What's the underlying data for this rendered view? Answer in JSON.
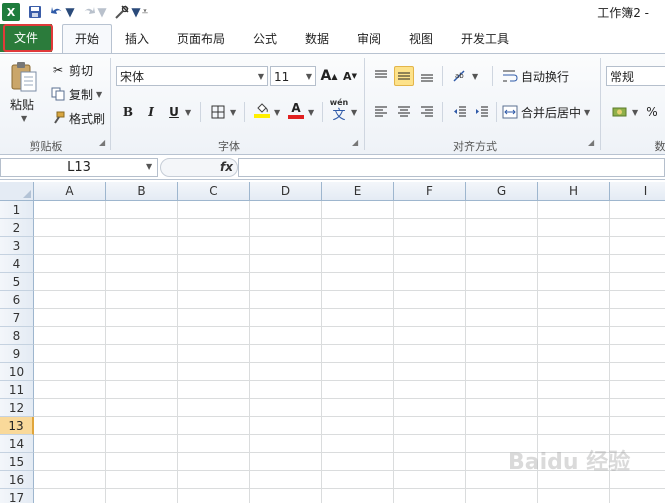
{
  "window": {
    "title": "工作簿2 -"
  },
  "quick_access": {
    "app_icon_letter": "X",
    "save_icon": "save-icon",
    "undo_icon": "undo-icon",
    "redo_icon": "redo-icon",
    "customize_icon": "tool-icon"
  },
  "tabs": [
    {
      "label": "文件"
    },
    {
      "label": "开始"
    },
    {
      "label": "插入"
    },
    {
      "label": "页面布局"
    },
    {
      "label": "公式"
    },
    {
      "label": "数据"
    },
    {
      "label": "审阅"
    },
    {
      "label": "视图"
    },
    {
      "label": "开发工具"
    }
  ],
  "ribbon": {
    "clipboard": {
      "group_label": "剪贴板",
      "paste_label": "粘贴",
      "cut_label": "剪切",
      "copy_label": "复制",
      "format_painter_label": "格式刷"
    },
    "font": {
      "group_label": "字体",
      "font_name": "宋体",
      "font_size": "11",
      "grow_glyph": "A",
      "shrink_glyph": "A",
      "bold": "B",
      "italic": "I",
      "underline": "U",
      "font_color_glyph": "A",
      "phonetic_top": "wén",
      "phonetic_bottom": "文",
      "highlight_color": "#ffef00",
      "font_color": "#e02020"
    },
    "alignment": {
      "group_label": "对齐方式",
      "wrap_text_label": "自动换行",
      "merge_center_label": "合并后居中"
    },
    "number": {
      "group_label": "数",
      "format_value": "常规",
      "percent_glyph": "%"
    }
  },
  "formula_bar": {
    "name_box": "L13",
    "fx_label": "fx",
    "formula_value": ""
  },
  "grid": {
    "columns": [
      "A",
      "B",
      "C",
      "D",
      "E",
      "F",
      "G",
      "H",
      "I"
    ],
    "rows": [
      "1",
      "2",
      "3",
      "4",
      "5",
      "6",
      "7",
      "8",
      "9",
      "10",
      "11",
      "12",
      "13",
      "14",
      "15",
      "16",
      "17"
    ],
    "selected_row": "13"
  },
  "watermark": {
    "text": "Baidu 经验"
  },
  "colors": {
    "file_tab": "#2b7b3b",
    "file_tab_outline": "#e03a3a",
    "active_align_button": "#fde28a",
    "selected_row_header": "#f9d99a"
  }
}
